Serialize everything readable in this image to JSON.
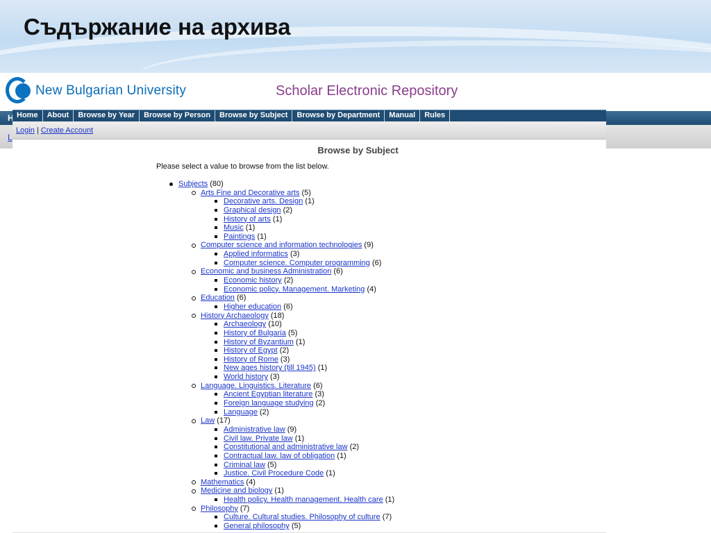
{
  "slide": {
    "title": "Съдържание на архива"
  },
  "header": {
    "university": "New Bulgarian University",
    "repository": "Scholar Electronic Repository"
  },
  "background_page": {
    "nav_letter": "H",
    "link_letter": "L"
  },
  "nav": {
    "items": [
      "Home",
      "About",
      "Browse by Year",
      "Browse by Person",
      "Browse by Subject",
      "Browse by Department",
      "Manual",
      "Rules"
    ]
  },
  "account": {
    "login": "Login",
    "separator": "|",
    "create": "Create Account"
  },
  "main": {
    "heading": "Browse by Subject",
    "intro": "Please select a value to browse from the list below.",
    "root": {
      "label": "Subjects",
      "count": "(80)"
    },
    "subjects": [
      {
        "label": "Arts Fine and Decorative arts",
        "count": "(5)",
        "children": [
          {
            "label": "Decorative arts. Design",
            "count": "(1)"
          },
          {
            "label": "Graphical design",
            "count": "(2)"
          },
          {
            "label": "History of arts",
            "count": "(1)"
          },
          {
            "label": "Music",
            "count": "(1)"
          },
          {
            "label": "Paintings",
            "count": "(1)"
          }
        ]
      },
      {
        "label": "Computer science and information technologies",
        "count": "(9)",
        "children": [
          {
            "label": "Applied informatics",
            "count": "(3)"
          },
          {
            "label": "Computer science. Computer programming",
            "count": "(6)"
          }
        ]
      },
      {
        "label": "Economic and business Administration",
        "count": "(6)",
        "children": [
          {
            "label": "Economic history",
            "count": "(2)"
          },
          {
            "label": "Economic policy. Management. Marketing",
            "count": "(4)"
          }
        ]
      },
      {
        "label": "Education",
        "count": "(6)",
        "children": [
          {
            "label": "Higher education",
            "count": "(6)"
          }
        ]
      },
      {
        "label": "History Archaeology",
        "count": "(18)",
        "children": [
          {
            "label": "Archaeology",
            "count": "(10)"
          },
          {
            "label": "History of Bulgaria",
            "count": "(5)"
          },
          {
            "label": "History of Byzantium",
            "count": "(1)"
          },
          {
            "label": "History of Egypt",
            "count": "(2)"
          },
          {
            "label": "History of Rome",
            "count": "(3)"
          },
          {
            "label": "New ages history (till 1945)",
            "count": "(1)"
          },
          {
            "label": "World history",
            "count": "(3)"
          }
        ]
      },
      {
        "label": "Language. Linguistics. Literature",
        "count": "(6)",
        "children": [
          {
            "label": "Ancient Egyptian literature",
            "count": "(3)"
          },
          {
            "label": "Foreign language studying",
            "count": "(2)"
          },
          {
            "label": "Language",
            "count": "(2)"
          }
        ]
      },
      {
        "label": "Law",
        "count": "(17)",
        "children": [
          {
            "label": "Administrative law",
            "count": "(9)"
          },
          {
            "label": "Civil law. Private law",
            "count": "(1)"
          },
          {
            "label": "Constitutional and administrative law",
            "count": "(2)"
          },
          {
            "label": "Contractual law. law of obligation",
            "count": "(1)"
          },
          {
            "label": "Criminal law",
            "count": "(5)"
          },
          {
            "label": "Justice. Civil Procedure Code",
            "count": "(1)"
          }
        ]
      },
      {
        "label": "Mathematics",
        "count": "(4)",
        "children": []
      },
      {
        "label": "Medicine and biology",
        "count": "(1)",
        "children": [
          {
            "label": "Health policy. Health management. Health care",
            "count": "(1)"
          }
        ]
      },
      {
        "label": "Philosophy",
        "count": "(7)",
        "children": [
          {
            "label": "Culture. Cultural studies. Philosophy of culture",
            "count": "(7)"
          },
          {
            "label": "General philosophy",
            "count": "(5)"
          }
        ]
      }
    ]
  }
}
